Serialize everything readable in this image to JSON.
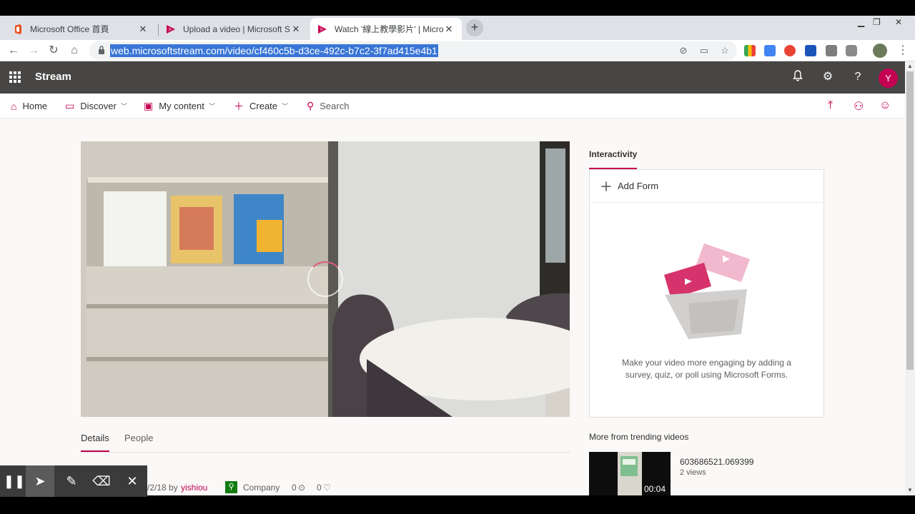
{
  "browser": {
    "tabs": [
      {
        "title": "Microsoft Office 首頁",
        "active": false,
        "icon": "office-favicon"
      },
      {
        "title": "Upload a video | Microsoft Stre",
        "active": false,
        "icon": "stream-favicon"
      },
      {
        "title": "Watch '線上教學影片' | Microsof",
        "active": true,
        "icon": "stream-favicon"
      }
    ],
    "new_tab": "+",
    "url": "web.microsoftstream.com/video/cf460c5b-d3ce-492c-b7c2-3f7ad415e4b1"
  },
  "app": {
    "brand": "Stream",
    "avatar_initial": "Y",
    "accent_color": "#c30052",
    "nav": {
      "home": "Home",
      "discover": "Discover",
      "my_content": "My content",
      "create": "Create",
      "search_placeholder": "Search"
    },
    "details_tabs": {
      "details": "Details",
      "people": "People"
    },
    "meta": {
      "date_partial": "/2/18 by",
      "author": "yishiou",
      "permission": "Company",
      "views": "0",
      "likes": "0"
    },
    "interactivity": {
      "title": "Interactivity",
      "add_form": "Add Form",
      "description": "Make your video more engaging by adding a survey, quiz, or poll using Microsoft Forms."
    },
    "trending": {
      "title": "More from trending videos",
      "video_title": "603686521.069399",
      "views": "2 views",
      "duration": "00:04"
    }
  }
}
